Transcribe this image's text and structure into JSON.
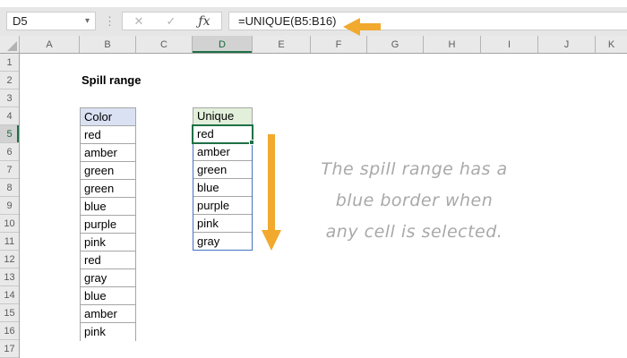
{
  "formula_bar": {
    "name_box_value": "D5",
    "dropdown_glyph": "▾",
    "dots_glyph": "⋮",
    "cancel_glyph": "✕",
    "enter_glyph": "✓",
    "fx_glyph": "ƒx",
    "formula": "=UNIQUE(B5:B16)"
  },
  "grid": {
    "selected_cell": "D5",
    "column_headers": [
      "A",
      "B",
      "C",
      "D",
      "E",
      "F",
      "G",
      "H",
      "I",
      "J",
      "K"
    ],
    "row_headers": [
      "1",
      "2",
      "3",
      "4",
      "5",
      "6",
      "7",
      "8",
      "9",
      "10",
      "11",
      "12",
      "13",
      "14",
      "15",
      "16",
      "17"
    ],
    "title_cell": "Spill range",
    "source_table": {
      "header": "Color",
      "values": [
        "red",
        "amber",
        "green",
        "green",
        "blue",
        "purple",
        "pink",
        "red",
        "gray",
        "blue",
        "amber",
        "pink"
      ]
    },
    "spill_table": {
      "header": "Unique",
      "active_value": "red",
      "values_rest": [
        "amber",
        "green",
        "blue",
        "purple",
        "pink",
        "gray"
      ]
    }
  },
  "annotation": {
    "line1": "The spill range has a",
    "line2": "blue border when",
    "line3": "any cell is selected."
  },
  "colors": {
    "accent_green": "#1E7145",
    "spill_border_blue": "#4472C4",
    "arrow_gold": "#F1A92E",
    "source_header_fill": "#D9E1F2",
    "spill_header_fill": "#E2EFDA",
    "chrome_gray": "#E6E6E6",
    "annotation_gray": "#A9A9A9"
  }
}
